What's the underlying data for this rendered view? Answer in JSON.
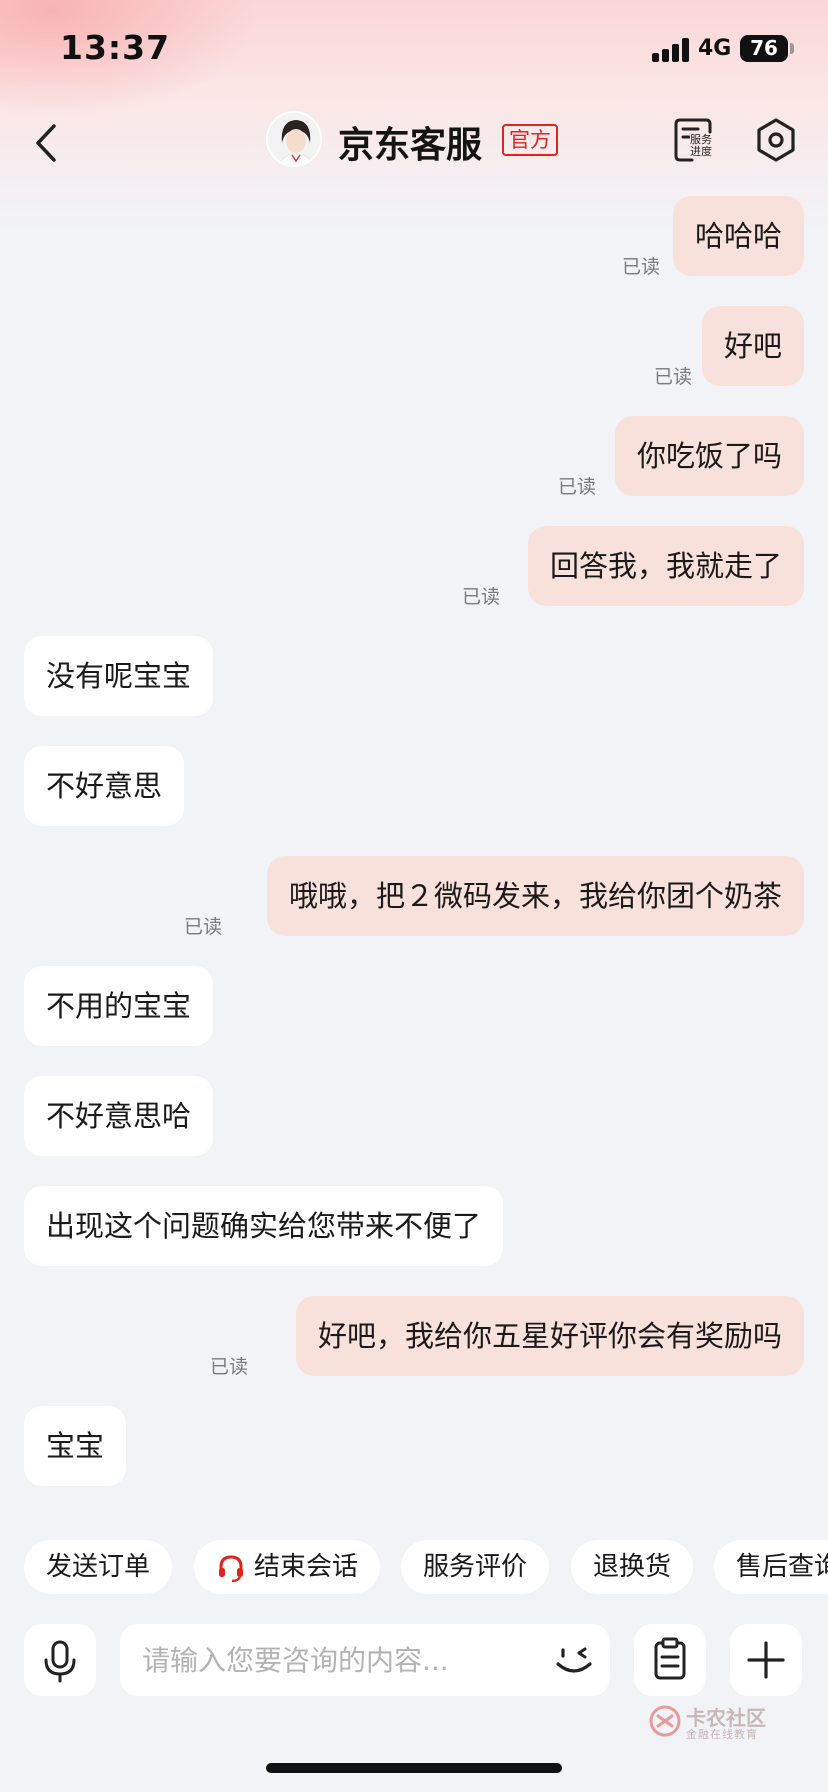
{
  "status_bar": {
    "time": "13:37",
    "network": "4G",
    "battery": "76"
  },
  "header": {
    "title": "京东客服",
    "badge": "官方",
    "service_progress_label": "服务进度",
    "icons": {
      "back": "chevron-left-icon",
      "service_progress": "document-progress-icon",
      "settings": "hexagon-settings-icon"
    }
  },
  "messages": [
    {
      "side": "out",
      "text": "哈哈哈",
      "status": "已读"
    },
    {
      "side": "out",
      "text": "好吧",
      "status": "已读"
    },
    {
      "side": "out",
      "text": "你吃饭了吗",
      "status": "已读"
    },
    {
      "side": "out",
      "text": "回答我，我就走了",
      "status": "已读"
    },
    {
      "side": "in",
      "text": "没有呢宝宝"
    },
    {
      "side": "in",
      "text": "不好意思"
    },
    {
      "side": "out",
      "text": "哦哦，把２微码发来，我给你团个奶茶",
      "status": "已读"
    },
    {
      "side": "in",
      "text": "不用的宝宝"
    },
    {
      "side": "in",
      "text": "不好意思哈"
    },
    {
      "side": "in",
      "text": "出现这个问题确实给您带来不便了"
    },
    {
      "side": "out",
      "text": "好吧，我给你五星好评你会有奖励吗",
      "status": "已读"
    },
    {
      "side": "in",
      "text": "宝宝"
    }
  ],
  "quick_actions": [
    "发送订单",
    "结束会话",
    "服务评价",
    "退换货",
    "售后查询"
  ],
  "input": {
    "placeholder": "请输入您要咨询的内容..."
  },
  "watermark": {
    "title": "卡农社区",
    "subtitle": "金融在线教育"
  },
  "colors": {
    "outgoing_bubble": "#f8e1db",
    "incoming_bubble": "#ffffff",
    "accent_red": "#e2231a",
    "background": "#f2f3f7"
  }
}
